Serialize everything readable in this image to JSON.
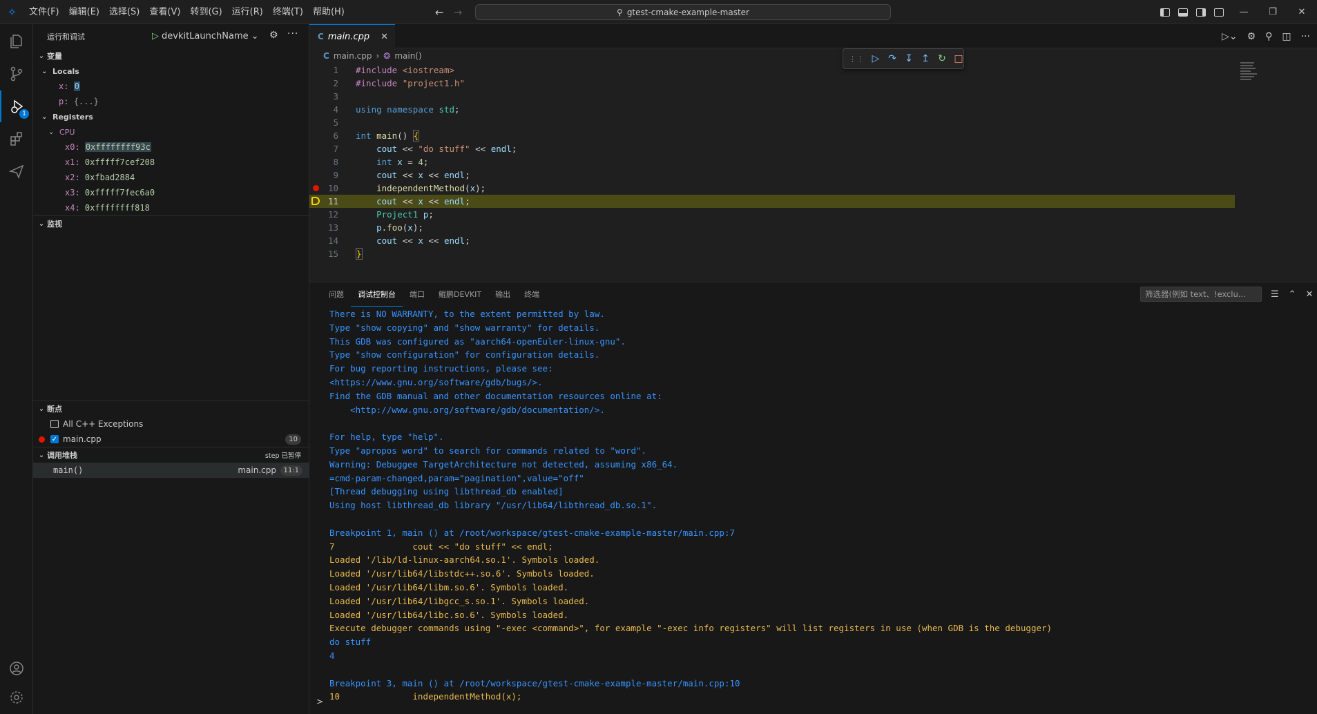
{
  "menu": [
    "文件(F)",
    "编辑(E)",
    "选择(S)",
    "查看(V)",
    "转到(G)",
    "运行(R)",
    "终端(T)",
    "帮助(H)"
  ],
  "command_center": "gtest-cmake-example-master",
  "sidebar": {
    "title": "运行和调试",
    "launch_config": "devkitLaunchName",
    "variables_title": "变量",
    "locals_title": "Locals",
    "locals": [
      {
        "name": "x:",
        "value": "0"
      },
      {
        "name": "p:",
        "value": "{...}"
      }
    ],
    "registers_title": "Registers",
    "cpu_title": "CPU",
    "registers": [
      {
        "name": "x0:",
        "value": "0xffffffff93c"
      },
      {
        "name": "x1:",
        "value": "0xfffff7cef208"
      },
      {
        "name": "x2:",
        "value": "0xfbad2884"
      },
      {
        "name": "x3:",
        "value": "0xfffff7fec6a0"
      },
      {
        "name": "x4:",
        "value": "0xffffffff818"
      }
    ],
    "watch_title": "监视",
    "breakpoints_title": "断点",
    "breakpoints": [
      {
        "label": "All C++ Exceptions",
        "checked": false
      },
      {
        "label": "main.cpp",
        "checked": true,
        "count": "10"
      }
    ],
    "callstack_title": "调用堆栈",
    "callstack_status": "step 已暂停",
    "callstack": [
      {
        "frame": "main()",
        "file": "main.cpp",
        "pos": "11:1"
      }
    ],
    "debug_badge": "1"
  },
  "editor": {
    "tab_label": "main.cpp",
    "breadcrumb_file": "main.cpp",
    "breadcrumb_symbol": "main()",
    "line_numbers": [
      "1",
      "2",
      "3",
      "4",
      "5",
      "6",
      "7",
      "8",
      "9",
      "10",
      "11",
      "12",
      "13",
      "14",
      "15"
    ]
  },
  "panel": {
    "tabs": [
      "问题",
      "调试控制台",
      "端口",
      "鲲鹏DEVKIT",
      "输出",
      "终端"
    ],
    "filter_placeholder": "筛选器(例如 text、!exclu...",
    "console": [
      {
        "t": "There is NO WARRANTY, to the extent permitted by law.",
        "c": "b"
      },
      {
        "t": "Type \"show copying\" and \"show warranty\" for details.",
        "c": "b"
      },
      {
        "t": "This GDB was configured as \"aarch64-openEuler-linux-gnu\".",
        "c": "b"
      },
      {
        "t": "Type \"show configuration\" for configuration details.",
        "c": "b"
      },
      {
        "t": "For bug reporting instructions, please see:",
        "c": "b"
      },
      {
        "t": "<https://www.gnu.org/software/gdb/bugs/>.",
        "c": "b"
      },
      {
        "t": "Find the GDB manual and other documentation resources online at:",
        "c": "b"
      },
      {
        "t": "    <http://www.gnu.org/software/gdb/documentation/>.",
        "c": "b"
      },
      {
        "t": "",
        "c": "b"
      },
      {
        "t": "For help, type \"help\".",
        "c": "b"
      },
      {
        "t": "Type \"apropos word\" to search for commands related to \"word\".",
        "c": "b"
      },
      {
        "t": "Warning: Debuggee TargetArchitecture not detected, assuming x86_64.",
        "c": "b"
      },
      {
        "t": "=cmd-param-changed,param=\"pagination\",value=\"off\"",
        "c": "b"
      },
      {
        "t": "[Thread debugging using libthread_db enabled]",
        "c": "b"
      },
      {
        "t": "Using host libthread_db library \"/usr/lib64/libthread_db.so.1\".",
        "c": "b"
      },
      {
        "t": "",
        "c": "b"
      },
      {
        "t": "Breakpoint 1, main () at /root/workspace/gtest-cmake-example-master/main.cpp:7",
        "c": "b"
      },
      {
        "t": "7               cout << \"do stuff\" << endl;",
        "c": "y"
      },
      {
        "t": "Loaded '/lib/ld-linux-aarch64.so.1'. Symbols loaded.",
        "c": "y"
      },
      {
        "t": "Loaded '/usr/lib64/libstdc++.so.6'. Symbols loaded.",
        "c": "y"
      },
      {
        "t": "Loaded '/usr/lib64/libm.so.6'. Symbols loaded.",
        "c": "y"
      },
      {
        "t": "Loaded '/usr/lib64/libgcc_s.so.1'. Symbols loaded.",
        "c": "y"
      },
      {
        "t": "Loaded '/usr/lib64/libc.so.6'. Symbols loaded.",
        "c": "y"
      },
      {
        "t": "Execute debugger commands using \"-exec <command>\", for example \"-exec info registers\" will list registers in use (when GDB is the debugger)",
        "c": "y"
      },
      {
        "t": "do stuff",
        "c": "b"
      },
      {
        "t": "4",
        "c": "b"
      },
      {
        "t": "",
        "c": "b"
      },
      {
        "t": "Breakpoint 3, main () at /root/workspace/gtest-cmake-example-master/main.cpp:10",
        "c": "b"
      },
      {
        "t": "10              independentMethod(x);",
        "c": "y"
      }
    ],
    "prompt": ">"
  }
}
